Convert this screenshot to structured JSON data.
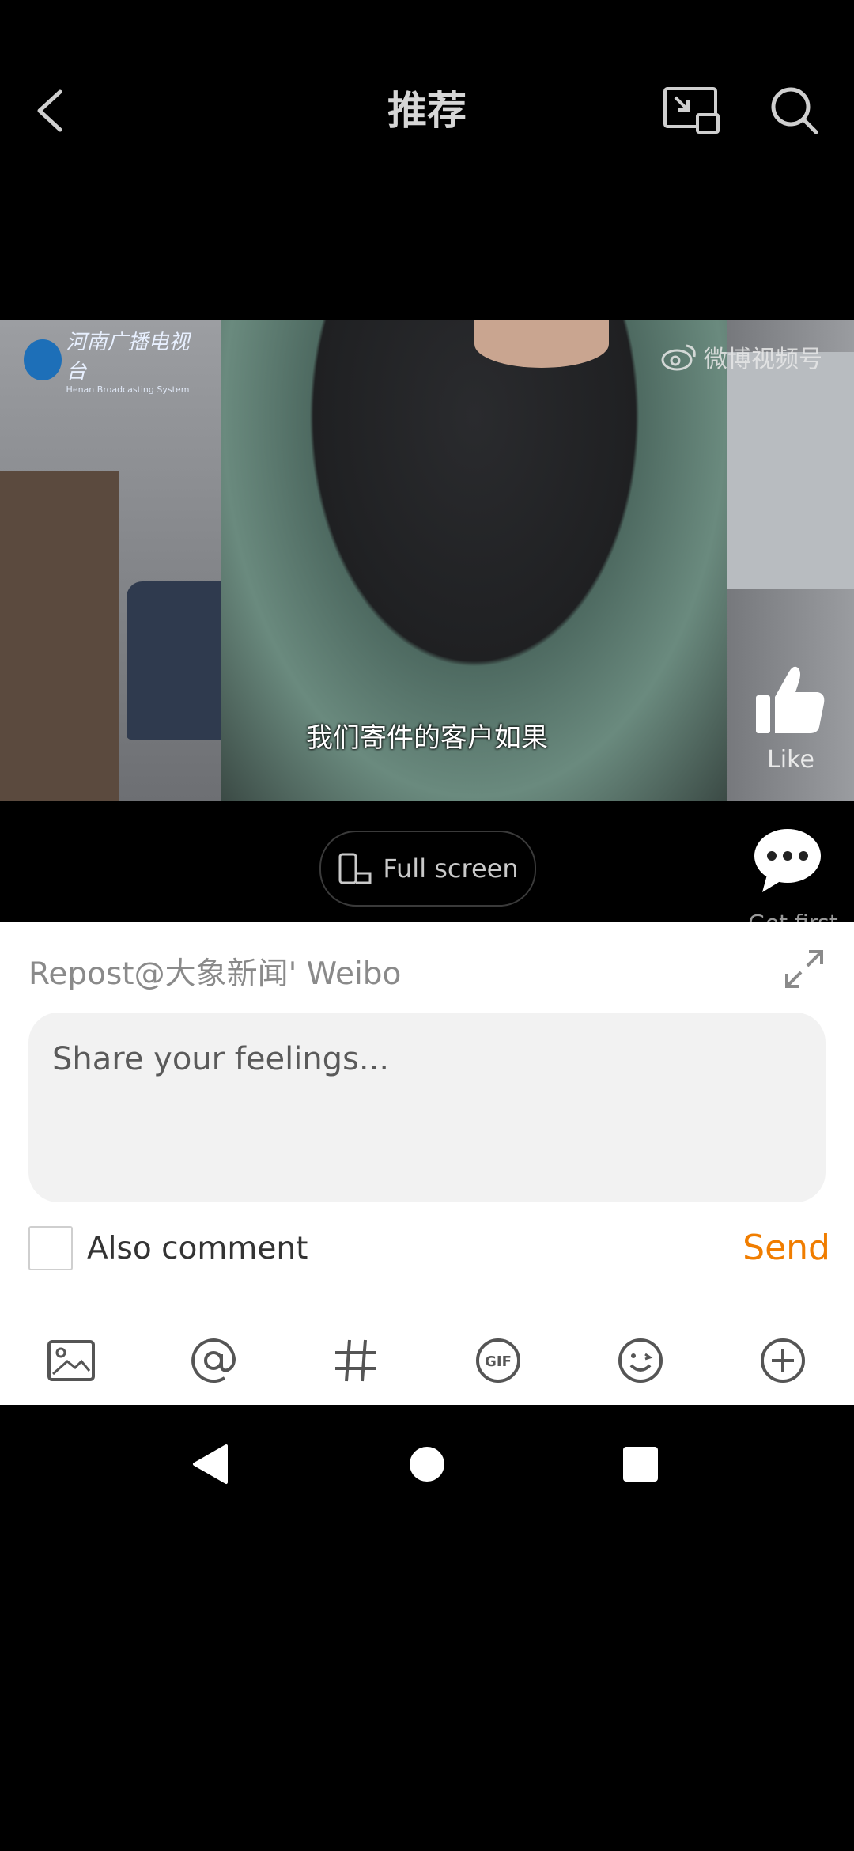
{
  "header": {
    "title": "推荐"
  },
  "video": {
    "subtitle": "我们寄件的客户如果",
    "logo_left_cn": "河南广播电视台",
    "logo_left_en": "Henan Broadcasting System",
    "logo_right": "微博视频号",
    "like_label": "Like"
  },
  "fullscreen_label": "Full screen",
  "comment": {
    "get_first_label": "Get first"
  },
  "sheet": {
    "repost_label": "Repost@大象新闻' Weibo",
    "input_placeholder": "Share your feelings...",
    "also_comment_label": "Also comment",
    "send_label": "Send",
    "toolbar_icons": [
      "image-icon",
      "at-icon",
      "hashtag-icon",
      "gif-icon",
      "emoji-icon",
      "plus-icon"
    ]
  },
  "colors": {
    "accent": "#f07d00"
  }
}
